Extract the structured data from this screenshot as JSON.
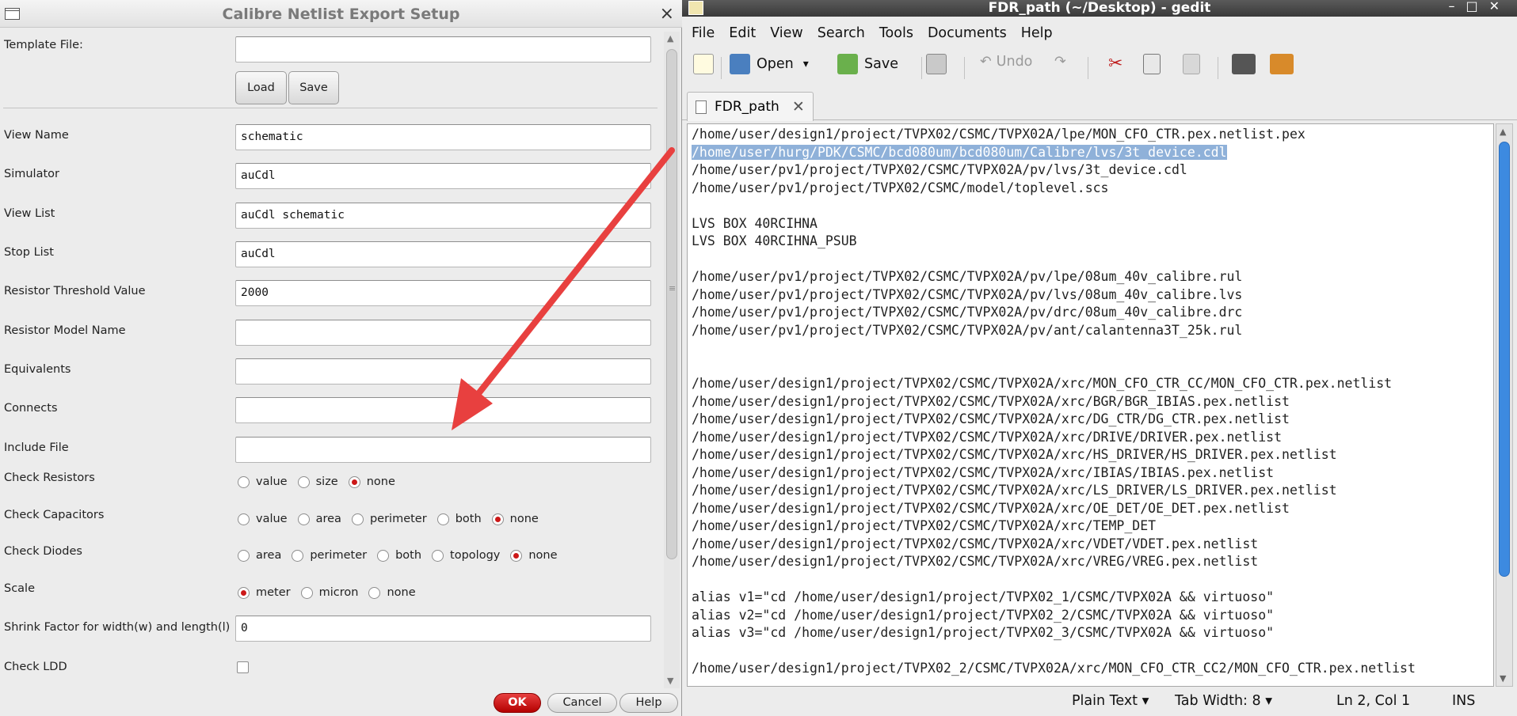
{
  "dialog": {
    "title": "Calibre Netlist Export Setup",
    "close": "×",
    "template_label": "Template File:",
    "template_value": "",
    "load": "Load",
    "save": "Save",
    "fields": [
      {
        "label": "View Name",
        "value": "schematic"
      },
      {
        "label": "Simulator",
        "value": "auCdl"
      },
      {
        "label": "View List",
        "value": "auCdl schematic"
      },
      {
        "label": "Stop List",
        "value": "auCdl"
      },
      {
        "label": "Resistor Threshold Value",
        "value": "2000"
      },
      {
        "label": "Resistor Model Name",
        "value": ""
      },
      {
        "label": "Equivalents",
        "value": ""
      },
      {
        "label": "Connects",
        "value": ""
      },
      {
        "label": "Include File",
        "value": ""
      }
    ],
    "radio_groups": [
      {
        "label": "Check Resistors",
        "options": [
          "value",
          "size",
          "none"
        ],
        "selected": "none"
      },
      {
        "label": "Check Capacitors",
        "options": [
          "value",
          "area",
          "perimeter",
          "both",
          "none"
        ],
        "selected": "none"
      },
      {
        "label": "Check Diodes",
        "options": [
          "area",
          "perimeter",
          "both",
          "topology",
          "none"
        ],
        "selected": "none"
      },
      {
        "label": "Scale",
        "options": [
          "meter",
          "micron",
          "none"
        ],
        "selected": "meter"
      }
    ],
    "shrink_label": "Shrink Factor for width(w) and length(l)",
    "shrink_value": "0",
    "ldd_label": "Check LDD",
    "ldd_checked": false,
    "ok": "OK",
    "cancel": "Cancel",
    "help": "Help"
  },
  "gedit": {
    "title": "FDR_path (~/Desktop) - gedit",
    "menu": [
      "File",
      "Edit",
      "View",
      "Search",
      "Tools",
      "Documents",
      "Help"
    ],
    "toolbar": {
      "open": "Open",
      "save": "Save",
      "undo": "Undo"
    },
    "tab": "FDR_path",
    "lines": [
      "/home/user/design1/project/TVPX02/CSMC/TVPX02A/lpe/MON_CFO_CTR.pex.netlist.pex",
      "/home/user/hurg/PDK/CSMC/bcd080um/bcd080um/Calibre/lvs/3t_device.cdl",
      "/home/user/pv1/project/TVPX02/CSMC/TVPX02A/pv/lvs/3t_device.cdl",
      "/home/user/pv1/project/TVPX02/CSMC/model/toplevel.scs",
      "",
      "LVS BOX 40RCIHNA",
      "LVS BOX 40RCIHNA_PSUB",
      "",
      "/home/user/pv1/project/TVPX02/CSMC/TVPX02A/pv/lpe/08um_40v_calibre.rul",
      "/home/user/pv1/project/TVPX02/CSMC/TVPX02A/pv/lvs/08um_40v_calibre.lvs",
      "/home/user/pv1/project/TVPX02/CSMC/TVPX02A/pv/drc/08um_40v_calibre.drc",
      "/home/user/pv1/project/TVPX02/CSMC/TVPX02A/pv/ant/calantenna3T_25k.rul",
      "",
      "",
      "/home/user/design1/project/TVPX02/CSMC/TVPX02A/xrc/MON_CFO_CTR_CC/MON_CFO_CTR.pex.netlist",
      "/home/user/design1/project/TVPX02/CSMC/TVPX02A/xrc/BGR/BGR_IBIAS.pex.netlist",
      "/home/user/design1/project/TVPX02/CSMC/TVPX02A/xrc/DG_CTR/DG_CTR.pex.netlist",
      "/home/user/design1/project/TVPX02/CSMC/TVPX02A/xrc/DRIVE/DRIVER.pex.netlist",
      "/home/user/design1/project/TVPX02/CSMC/TVPX02A/xrc/HS_DRIVER/HS_DRIVER.pex.netlist",
      "/home/user/design1/project/TVPX02/CSMC/TVPX02A/xrc/IBIAS/IBIAS.pex.netlist",
      "/home/user/design1/project/TVPX02/CSMC/TVPX02A/xrc/LS_DRIVER/LS_DRIVER.pex.netlist",
      "/home/user/design1/project/TVPX02/CSMC/TVPX02A/xrc/OE_DET/OE_DET.pex.netlist",
      "/home/user/design1/project/TVPX02/CSMC/TVPX02A/xrc/TEMP_DET",
      "/home/user/design1/project/TVPX02/CSMC/TVPX02A/xrc/VDET/VDET.pex.netlist",
      "/home/user/design1/project/TVPX02/CSMC/TVPX02A/xrc/VREG/VREG.pex.netlist",
      "",
      "alias v1=\"cd /home/user/design1/project/TVPX02_1/CSMC/TVPX02A && virtuoso\"",
      "alias v2=\"cd /home/user/design1/project/TVPX02_2/CSMC/TVPX02A && virtuoso\"",
      "alias v3=\"cd /home/user/design1/project/TVPX02_3/CSMC/TVPX02A && virtuoso\"",
      "",
      "/home/user/design1/project/TVPX02_2/CSMC/TVPX02A/xrc/MON_CFO_CTR_CC2/MON_CFO_CTR.pex.netlist"
    ],
    "selected_line": 1,
    "status": {
      "language": "Plain Text",
      "tab_width": "Tab Width:  8",
      "position": "Ln 2, Col 1",
      "mode": "INS"
    }
  },
  "colors": {
    "accent_red": "#e03a3a",
    "selection": "#8fb1d9",
    "scroll_thumb": "#3d8ae0"
  }
}
